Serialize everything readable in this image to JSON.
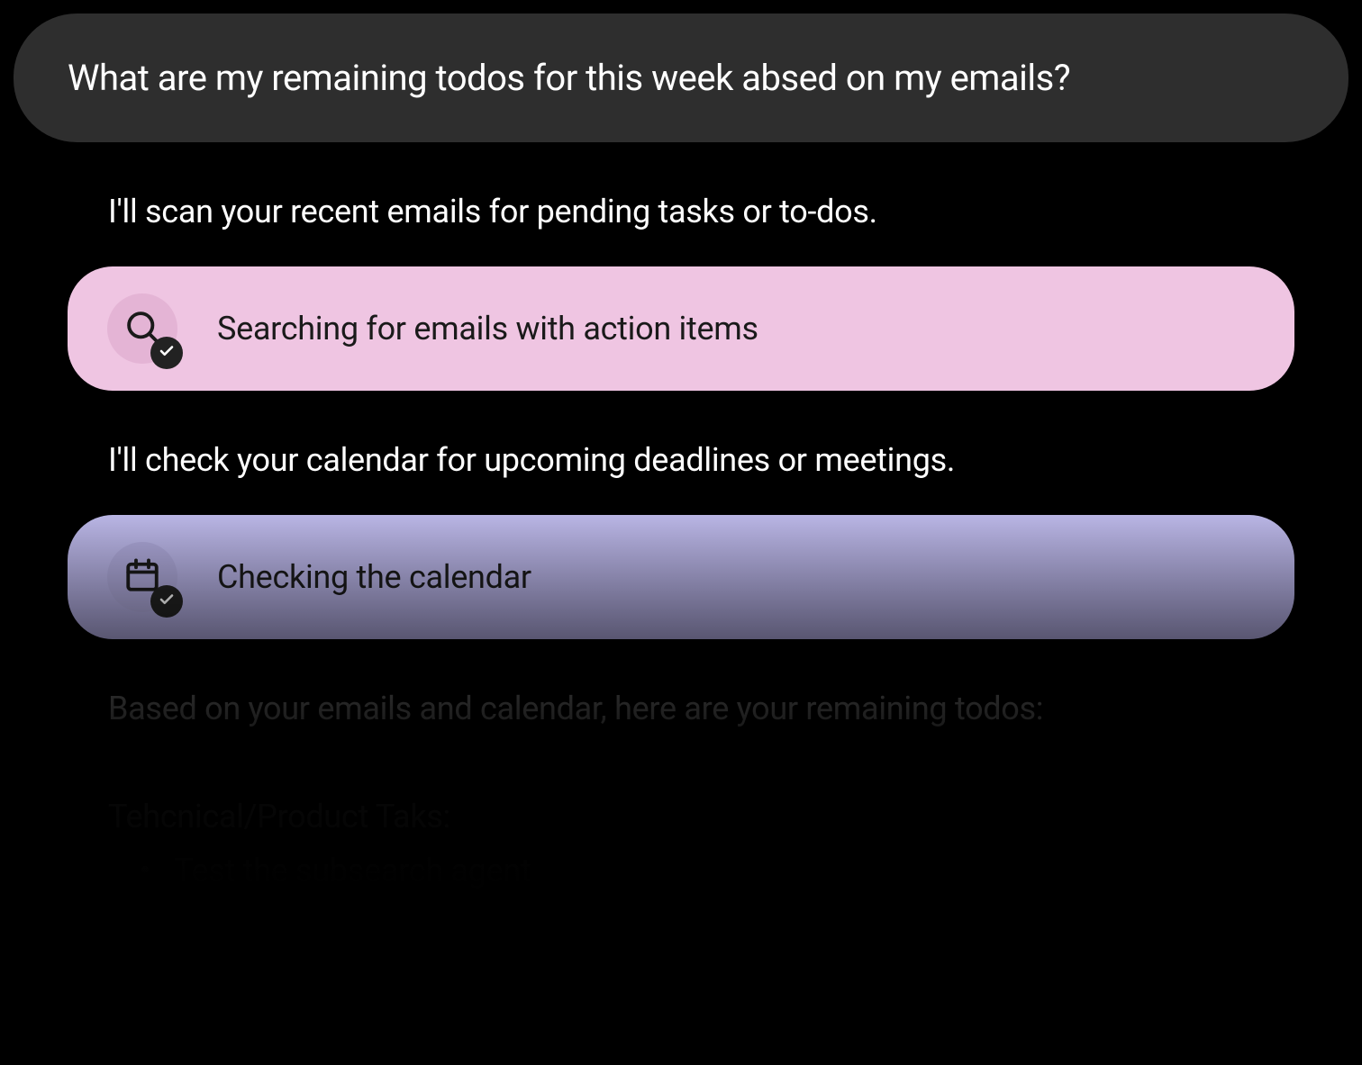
{
  "user_message": "What are my remaining todos for this week absed on my emails?",
  "assistant": {
    "intro_1": "I'll scan your recent emails for pending tasks or to-dos.",
    "intro_2": "I'll check your calendar for upcoming deadlines or meetings.",
    "results_intro": "Based on your emails and calendar, here are your remaining todos:"
  },
  "actions": {
    "search_emails": {
      "label": "Searching for emails with action items",
      "icon": "search-icon",
      "status": "complete",
      "color": "#efc5e2"
    },
    "check_calendar": {
      "label": "Checking the calendar",
      "icon": "calendar-icon",
      "status": "complete",
      "color": "#b9b5e4"
    }
  },
  "todos": {
    "categories": [
      {
        "heading": "Tehcnical/Product Taks:",
        "items": [
          "Test the subsearch agent"
        ]
      }
    ]
  }
}
